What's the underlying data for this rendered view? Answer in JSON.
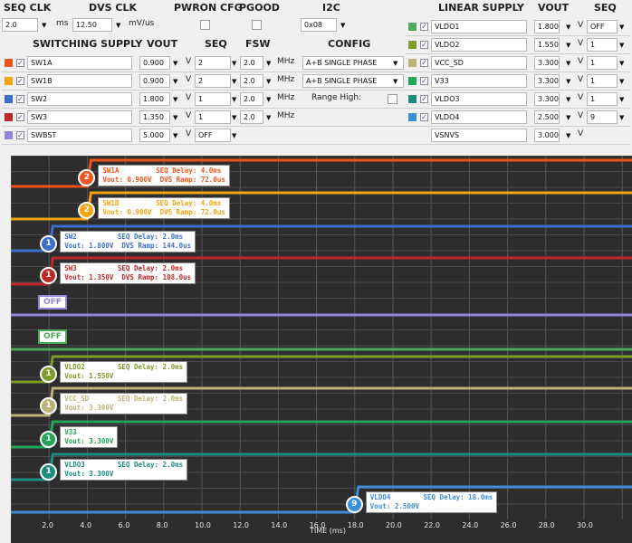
{
  "top_headers": {
    "seq_clk": "SEQ CLK",
    "dvs_clk": "DVS CLK",
    "pwron_cfg": "PWRON CFG",
    "pgood": "PGOOD",
    "i2c": "I2C",
    "linear_supply": "LINEAR SUPPLY",
    "vout": "VOUT",
    "seq": "SEQ"
  },
  "clock_row": {
    "seq_clk_value": "2.0",
    "seq_clk_unit": "ms",
    "dvs_clk_value": "12.50",
    "dvs_clk_unit": "mV/us",
    "i2c_value": "0x08"
  },
  "switching_headers": {
    "supply": "SWITCHING SUPPLY",
    "vout": "VOUT",
    "seq": "SEQ",
    "fsw": "FSW",
    "config": "CONFIG"
  },
  "switching": [
    {
      "name": "SW1A",
      "color": "#f0541c",
      "vout": "0.900",
      "seq": "2",
      "fsw": "2.0",
      "config": "A+B SINGLE PHASE"
    },
    {
      "name": "SW1B",
      "color": "#f5a313",
      "vout": "0.900",
      "seq": "2",
      "fsw": "2.0",
      "config": "A+B SINGLE PHASE"
    },
    {
      "name": "SW2",
      "color": "#3c6fc9",
      "vout": "1.800",
      "seq": "1",
      "fsw": "2.0",
      "config": "Range High:"
    },
    {
      "name": "SW3",
      "color": "#c0272a",
      "vout": "1.350",
      "seq": "1",
      "fsw": "2.0",
      "config": ""
    },
    {
      "name": "SWBST",
      "color": "#9185dc",
      "vout": "5.000",
      "seq": "OFF",
      "fsw": "",
      "config": ""
    }
  ],
  "linear": [
    {
      "name": "VLDO1",
      "color": "#4caa5c",
      "vout": "1.800",
      "seq": "OFF"
    },
    {
      "name": "VLDO2",
      "color": "#7f9b2a",
      "vout": "1.550",
      "seq": "1"
    },
    {
      "name": "VCC_SD",
      "color": "#bdb27a",
      "vout": "3.300",
      "seq": "1"
    },
    {
      "name": "V33",
      "color": "#24a55a",
      "vout": "3.300",
      "seq": "1"
    },
    {
      "name": "VLDO3",
      "color": "#1b8c7e",
      "vout": "3.300",
      "seq": "1"
    },
    {
      "name": "VLDO4",
      "color": "#3b8fd9",
      "vout": "2.500",
      "seq": "9"
    },
    {
      "name": "VSNVS",
      "color": "",
      "vout": "3.000",
      "seq": ""
    }
  ],
  "units": {
    "volt": "V",
    "mhz": "MHz"
  },
  "plot": {
    "x_axis_title": "TIME (ms)",
    "ticks": [
      "2.0",
      "4.0",
      "6.0",
      "8.0",
      "10.0",
      "12.0",
      "14.0",
      "16.0",
      "18.0",
      "20.0",
      "22.0",
      "24.0",
      "26.0",
      "28.0",
      "30.0"
    ],
    "off_label": "OFF",
    "traces": [
      {
        "name": "SW1A",
        "color": "#f0541c",
        "seq": "2",
        "line1": "SW1A         SEQ Delay: 4.0ms",
        "line2": "Vout: 0.900V  DVS Ramp: 72.0us"
      },
      {
        "name": "SW1B",
        "color": "#f5a313",
        "seq": "2",
        "line1": "SW1B         SEQ Delay: 4.0ms",
        "line2": "Vout: 0.900V  DVS Ramp: 72.0us"
      },
      {
        "name": "SW2",
        "color": "#3c6fc9",
        "seq": "1",
        "line1": "SW2          SEQ Delay: 2.0ms",
        "line2": "Vout: 1.800V  DVS Ramp: 144.0us"
      },
      {
        "name": "SW3",
        "color": "#c0272a",
        "seq": "1",
        "line1": "SW3          SEQ Delay: 2.0ms",
        "line2": "Vout: 1.350V  DVS Ramp: 108.0us"
      },
      {
        "name": "SWBST",
        "color": "#9185dc",
        "seq": "OFF"
      },
      {
        "name": "VLDO1",
        "color": "#4caa5c",
        "seq": "OFF"
      },
      {
        "name": "VLDO2",
        "color": "#7f9b2a",
        "seq": "1",
        "line1": "VLDO2        SEQ Delay: 2.0ms",
        "line2": "Vout: 1.550V"
      },
      {
        "name": "VCC_SD",
        "color": "#bdb27a",
        "seq": "1",
        "line1": "VCC_SD       SEQ Delay: 2.0ms",
        "line2": "Vout: 3.300V"
      },
      {
        "name": "V33",
        "color": "#24a55a",
        "seq": "1",
        "line1": "V33",
        "line2": "Vout: 3.300V"
      },
      {
        "name": "VLDO3",
        "color": "#1b8c7e",
        "seq": "1",
        "line1": "VLDO3        SEQ Delay: 2.0ms",
        "line2": "Vout: 3.300V"
      },
      {
        "name": "VLDO4",
        "color": "#3b8fd9",
        "seq": "9",
        "line1": "VLDO4        SEQ Delay: 18.0ms",
        "line2": "Vout: 2.500V"
      }
    ]
  }
}
